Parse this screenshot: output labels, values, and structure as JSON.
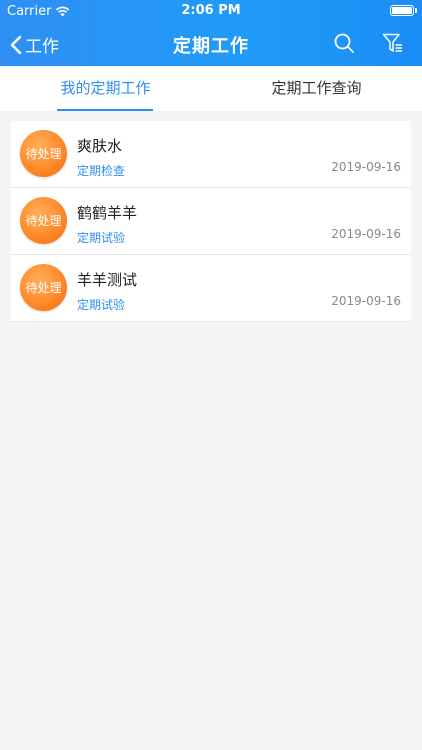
{
  "status": {
    "carrier": "Carrier",
    "time": "2:06 PM"
  },
  "nav": {
    "back_label": "工作",
    "title": "定期工作",
    "icons": [
      "search-icon",
      "filter-icon"
    ]
  },
  "tabs": [
    {
      "label": "我的定期工作",
      "active": true
    },
    {
      "label": "定期工作查询",
      "active": false
    }
  ],
  "items": [
    {
      "status": "待处理",
      "title": "爽肤水",
      "type": "定期检查",
      "date": "2019-09-16"
    },
    {
      "status": "待处理",
      "title": "鹤鹤羊羊",
      "type": "定期试验",
      "date": "2019-09-16"
    },
    {
      "status": "待处理",
      "title": "羊羊测试",
      "type": "定期试验",
      "date": "2019-09-16"
    }
  ],
  "colors": {
    "accent": "#2f8ff3",
    "badge": "#ff8a2a"
  }
}
